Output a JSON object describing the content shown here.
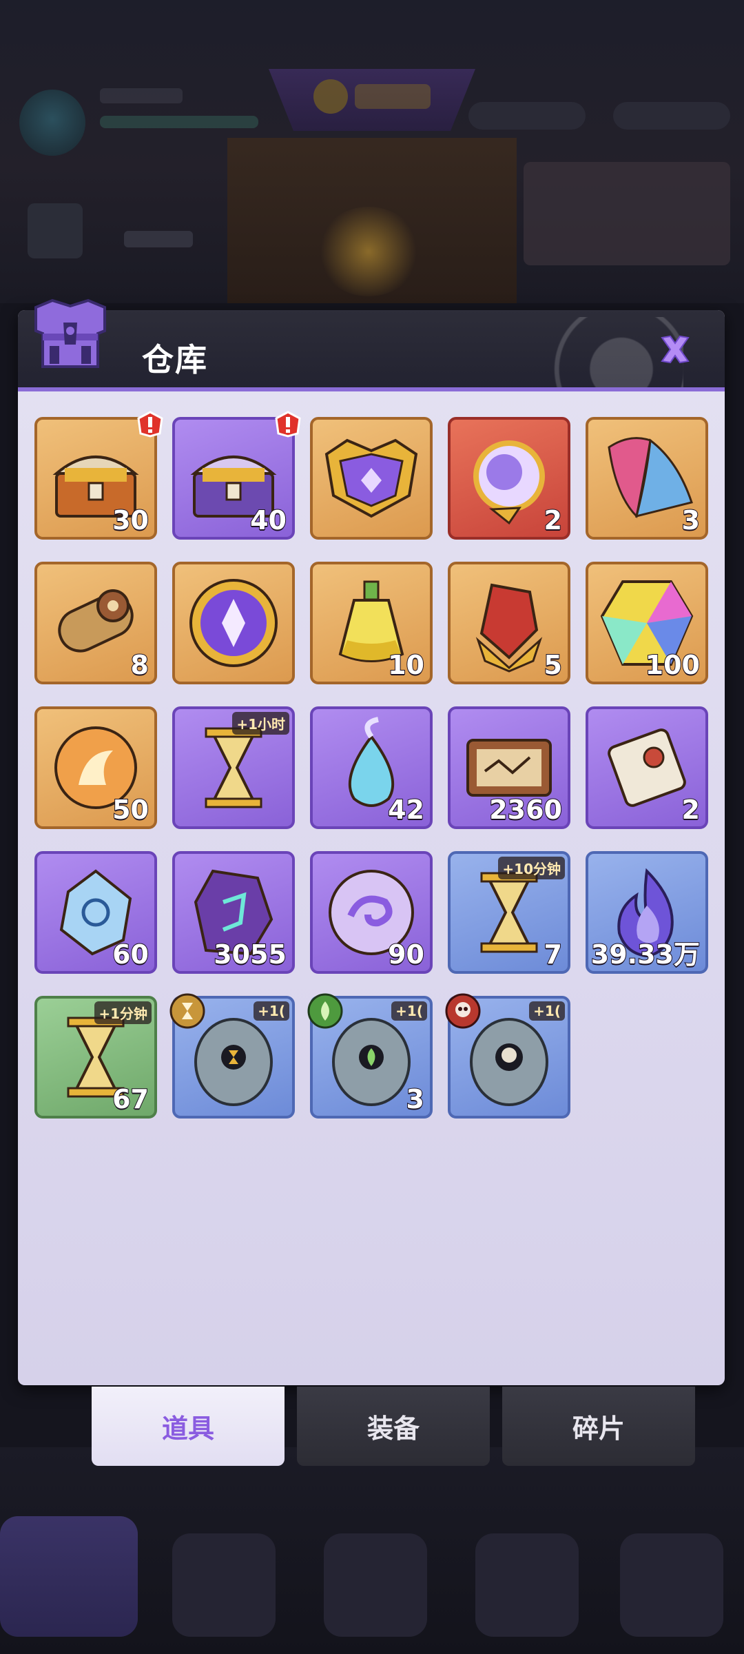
{
  "modal": {
    "title": "仓库"
  },
  "colors": {
    "accent": "#8a6cd6",
    "header": "#2d2d39",
    "panel": "#e4e1f2"
  },
  "items": [
    {
      "name": "golden-treasure-chest",
      "bg": "orange",
      "count": "30",
      "alert": true
    },
    {
      "name": "purple-treasure-chest",
      "bg": "purple",
      "count": "40",
      "alert": true
    },
    {
      "name": "ornate-purple-chest",
      "bg": "orange",
      "count": ""
    },
    {
      "name": "purple-orb-artifact",
      "bg": "red",
      "count": "2"
    },
    {
      "name": "feather-wing",
      "bg": "orange",
      "count": "3"
    },
    {
      "name": "summon-scroll",
      "bg": "orange",
      "count": "8"
    },
    {
      "name": "purple-emblem-coin",
      "bg": "orange",
      "count": ""
    },
    {
      "name": "golden-potion",
      "bg": "orange",
      "count": "10"
    },
    {
      "name": "red-crystal",
      "bg": "orange",
      "count": "5"
    },
    {
      "name": "rainbow-gem",
      "bg": "orange",
      "count": "100"
    },
    {
      "name": "fire-orb",
      "bg": "orange",
      "count": "50"
    },
    {
      "name": "hourglass-1h",
      "bg": "purple",
      "count": "",
      "tag": "+1小时"
    },
    {
      "name": "blue-spirit-drop",
      "bg": "purple",
      "count": "42"
    },
    {
      "name": "treasure-map-scroll",
      "bg": "purple",
      "count": "2360"
    },
    {
      "name": "parchment-scroll",
      "bg": "purple",
      "count": "2"
    },
    {
      "name": "ice-crystal",
      "bg": "purple",
      "count": "60"
    },
    {
      "name": "rune-stone",
      "bg": "purple",
      "count": "3055"
    },
    {
      "name": "swirl-orb",
      "bg": "purple",
      "count": "90"
    },
    {
      "name": "hourglass-10m",
      "bg": "blue",
      "count": "7",
      "tag": "+10分钟"
    },
    {
      "name": "blue-flame",
      "bg": "blue",
      "count": "39.33万"
    },
    {
      "name": "hourglass-1m",
      "bg": "green",
      "count": "67",
      "tag": "+1分钟"
    },
    {
      "name": "stone-egg-time",
      "bg": "blue",
      "count": "",
      "tag": "+1(",
      "badge": "time"
    },
    {
      "name": "stone-egg-nature",
      "bg": "blue",
      "count": "3",
      "tag": "+1(",
      "badge": "nature"
    },
    {
      "name": "stone-egg-skull",
      "bg": "blue",
      "count": "",
      "tag": "+1(",
      "badge": "skull"
    }
  ],
  "tabs": [
    {
      "label": "道具",
      "active": true
    },
    {
      "label": "装备",
      "active": false
    },
    {
      "label": "碎片",
      "active": false
    }
  ]
}
